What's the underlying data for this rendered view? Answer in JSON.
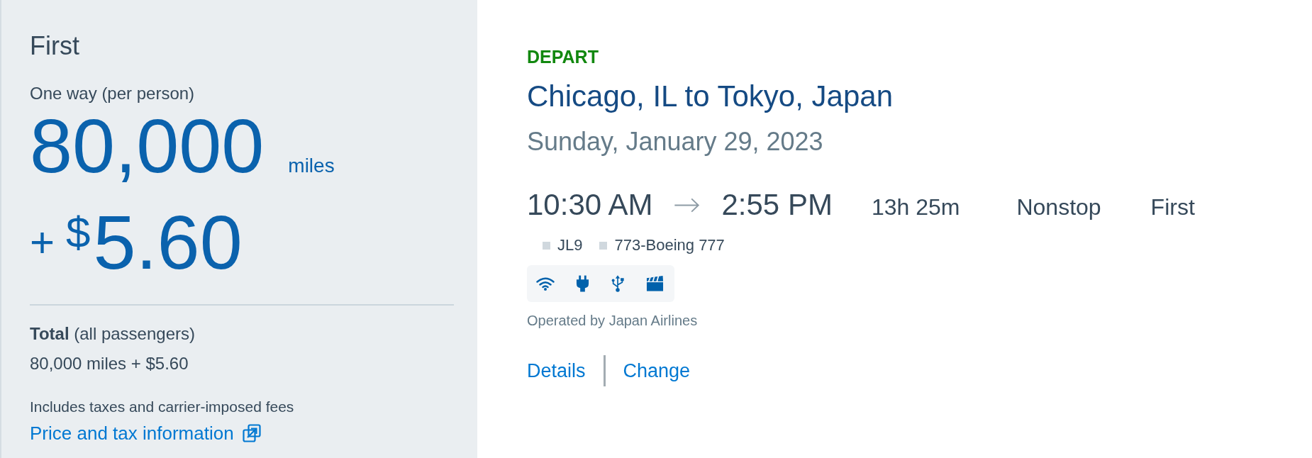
{
  "fare_panel": {
    "cabin": "First",
    "trip_type": "One way (per person)",
    "miles": "80,000",
    "miles_unit": "miles",
    "plus_sign": "+",
    "currency_symbol": "$",
    "cash_amount": "5.60",
    "total_label": "**Total** (all passengers)",
    "total_value": "80,000 miles + $5.60",
    "fees_note": "Includes taxes and carrier-imposed fees",
    "price_link": "Price and tax information"
  },
  "flight": {
    "direction": "DEPART",
    "route": "Chicago, IL to Tokyo, Japan",
    "date": "Sunday, January 29, 2023",
    "depart_time": "10:30 AM",
    "arrive_time": "2:55 PM",
    "duration": "13h 25m",
    "stops": "Nonstop",
    "cabin": "First",
    "flight_number": "JL9",
    "aircraft": "773-Boeing 777",
    "operator": "Operated by Japan Airlines",
    "links": [
      "Details",
      "Change"
    ]
  }
}
